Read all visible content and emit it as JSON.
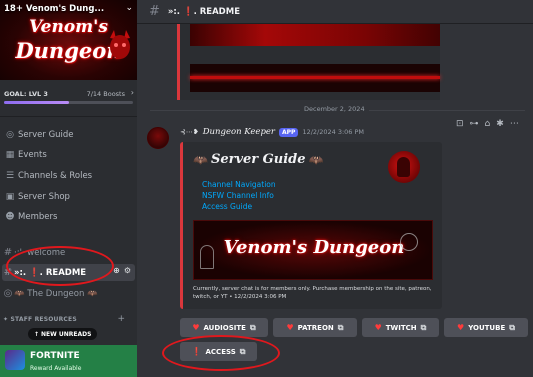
{
  "server": {
    "name": "18+ Venom's Dung...",
    "banner_line1": "Venom's",
    "banner_line2": "Dungeon",
    "goal_label": "GOAL: LVL 3",
    "boosts": "7/14 Boosts",
    "boost_progress": 0.5
  },
  "nav": [
    {
      "icon": "compass-icon",
      "glyph": "◎",
      "label": "Server Guide"
    },
    {
      "icon": "calendar-icon",
      "glyph": "▦",
      "label": "Events"
    },
    {
      "icon": "channels-roles-icon",
      "glyph": "☰",
      "label": "Channels & Roles"
    },
    {
      "icon": "shop-icon",
      "glyph": "▣",
      "label": "Server Shop"
    },
    {
      "icon": "members-icon",
      "glyph": "☻",
      "label": "Members"
    }
  ],
  "channels": [
    {
      "prefix": "#",
      "label": "·:'· welcome",
      "active": false
    },
    {
      "prefix": "#",
      "label": "»:. ❗. README",
      "active": true
    },
    {
      "prefix": "◎",
      "label": "🦇 The Dungeon 🦇",
      "active": false
    }
  ],
  "category": "✦ STAFF RESOURCES",
  "new_unreads": "NEW UNREADS",
  "promo": {
    "title": "FORTNITE",
    "subtitle": "Reward Available"
  },
  "topbar": {
    "channel_name": "»:. ❗. README"
  },
  "date_divider": "December 2, 2024",
  "message": {
    "author_prefix": "⊰⋯❥",
    "author": "Dungeon Keeper",
    "badge": "APP",
    "timestamp": "12/2/2024 3:06 PM",
    "embed": {
      "title_prefix": "🦇",
      "title": "Server Guide",
      "title_suffix": "🦇",
      "links": [
        "Channel Navigation",
        "NSFW Channel Info",
        "Access Guide"
      ],
      "image_text": "Venom's Dungeon",
      "footer": "Currently, server chat is for members only. Purchase membership on the site, patreon, twitch, or YT • 12/2/2024 3:06 PM"
    },
    "buttons": [
      {
        "label": "AUDIOSITE",
        "icon": "heart-icon",
        "glyph": "♥"
      },
      {
        "label": "PATREON",
        "icon": "patreon-icon",
        "glyph": "♥"
      },
      {
        "label": "TWITCH",
        "icon": "twitch-icon",
        "glyph": "♥"
      },
      {
        "label": "YOUTUBE",
        "icon": "youtube-icon",
        "glyph": "♥"
      },
      {
        "label": "ACCESS",
        "icon": "exclamation-icon",
        "glyph": "❗"
      }
    ]
  },
  "colors": {
    "accent": "#da373c",
    "link": "#00a8fc",
    "boost": "#b98cf6",
    "annotation": "#e0181d"
  }
}
